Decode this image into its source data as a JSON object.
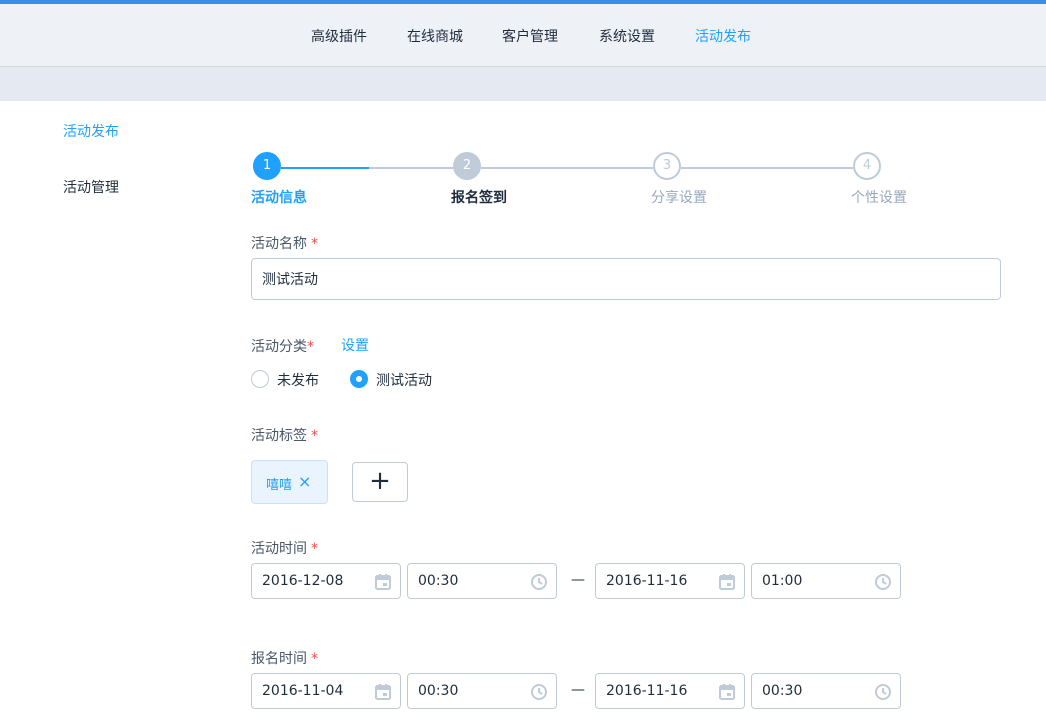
{
  "header": {
    "nav": [
      {
        "label": "高级插件",
        "active": false
      },
      {
        "label": "在线商城",
        "active": false
      },
      {
        "label": "客户管理",
        "active": false
      },
      {
        "label": "系统设置",
        "active": false
      },
      {
        "label": "活动发布",
        "active": true
      }
    ]
  },
  "sidebar": {
    "items": [
      {
        "label": "活动发布",
        "active": true
      },
      {
        "label": "活动管理",
        "active": false
      }
    ]
  },
  "steps": [
    {
      "num": "1",
      "title": "活动信息",
      "state": "active"
    },
    {
      "num": "2",
      "title": "报名签到",
      "state": "process"
    },
    {
      "num": "3",
      "title": "分享设置",
      "state": "wait"
    },
    {
      "num": "4",
      "title": "个性设置",
      "state": "wait"
    }
  ],
  "form": {
    "required_mark": "*",
    "name": {
      "label": "活动名称",
      "value": "测试活动"
    },
    "category": {
      "label": "活动分类",
      "settings_link": "设置",
      "options": [
        {
          "label": "未发布",
          "checked": false
        },
        {
          "label": "测试活动",
          "checked": true
        }
      ]
    },
    "tags": {
      "label": "活动标签",
      "items": [
        {
          "label": "嘻嘻",
          "close_icon": "×"
        }
      ],
      "add_label": "+"
    },
    "activity_time": {
      "label": "活动时间",
      "start_date": "2016-12-08",
      "start_time": "00:30",
      "separator": "—",
      "end_date": "2016-11-16",
      "end_time": "01:00"
    },
    "signup_time": {
      "label": "报名时间",
      "start_date": "2016-11-04",
      "start_time": "00:30",
      "separator": "—",
      "end_date": "2016-11-16",
      "end_time": "00:30"
    }
  },
  "colors": {
    "accent": "#20a0ff",
    "header_bg": "#eef1f6",
    "required": "#ff4949",
    "icon_grey": "#bfcbd9"
  },
  "icons": {
    "date": "calendar-icon",
    "time": "clock-icon"
  }
}
